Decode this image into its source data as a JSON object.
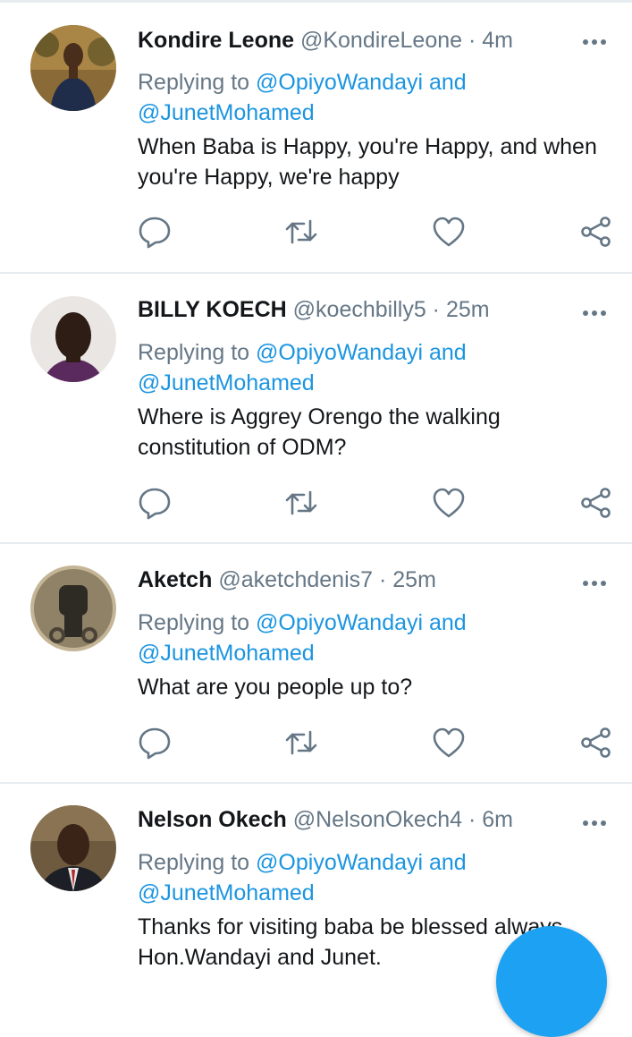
{
  "replies": [
    {
      "name": "Kondire Leone",
      "handle": "@KondireLeone",
      "time": "4m",
      "replying_prefix": "Replying to",
      "replying_first": "@OpiyoWandayi and",
      "replying_second": "@JunetMohamed",
      "text": "When Baba is Happy, you're Happy, and when\nyou're Happy, we're happy"
    },
    {
      "name": "BILLY KOECH",
      "handle": "@koechbilly5",
      "time": "25m",
      "replying_prefix": "Replying to",
      "replying_first": "@OpiyoWandayi and",
      "replying_second": "@JunetMohamed",
      "text": "Where is Aggrey Orengo the walking\nconstitution of ODM?"
    },
    {
      "name": "Aketch",
      "handle": "@aketchdenis7",
      "time": "25m",
      "replying_prefix": "Replying to",
      "replying_first": "@OpiyoWandayi and",
      "replying_second": "@JunetMohamed",
      "text": "What are you people up to?"
    },
    {
      "name": "Nelson Okech",
      "handle": "@NelsonOkech4",
      "time": "6m",
      "replying_prefix": "Replying to",
      "replying_first": "@OpiyoWandayi and",
      "replying_second": "@JunetMohamed",
      "text": "Thanks for visiting baba be blessed always\nHon.Wandayi and Junet."
    }
  ],
  "separator": "·",
  "icons": {
    "reply": "reply-icon",
    "retweet": "retweet-icon",
    "like": "heart-icon",
    "share": "share-icon",
    "more": "more-icon",
    "compose": "compose-button"
  },
  "colors": {
    "link": "#1b95e0",
    "secondary_text": "#657786",
    "primary_text": "#14171a",
    "accent": "#1da1f2"
  }
}
